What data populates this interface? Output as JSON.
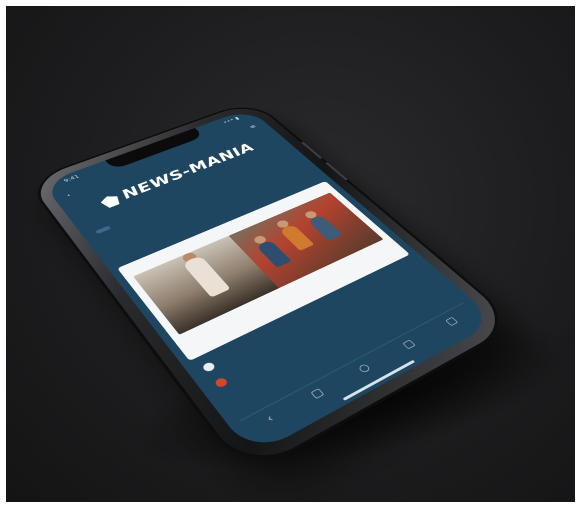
{
  "status_bar": {
    "left": "9:41",
    "right": "••• ▮"
  },
  "topbar": {
    "back_icon": "chevron-left-icon",
    "title": "",
    "menu_icon": "menu-icon"
  },
  "app": {
    "name": "NEWS-MANIA"
  },
  "nav_strip": {
    "active_tab": ""
  },
  "headline": {
    "title": "",
    "subtitle": ""
  },
  "card": {
    "caption": "",
    "section_title": ""
  },
  "list": {
    "items": [
      {
        "label": ""
      },
      {
        "label": ""
      }
    ]
  },
  "bottom_nav": {
    "items": [
      {
        "icon": "back-icon",
        "glyph": "‹"
      },
      {
        "icon": "square-icon",
        "glyph": "▢"
      },
      {
        "icon": "circle-icon",
        "glyph": "○"
      },
      {
        "icon": "square-icon",
        "glyph": "▢"
      },
      {
        "icon": "square-icon",
        "glyph": "▢"
      }
    ]
  },
  "colors": {
    "screen": "#1f4661",
    "card": "#f4f6f8",
    "accent": "#3b6a8b",
    "red": "#d9452b"
  }
}
